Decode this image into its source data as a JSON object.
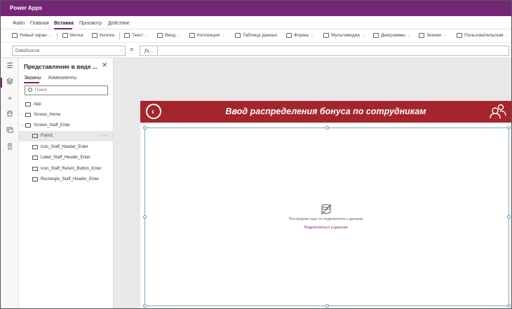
{
  "app": {
    "name": "Power Apps"
  },
  "menu": {
    "items": [
      {
        "label": "Файл",
        "active": false
      },
      {
        "label": "Главная",
        "active": false
      },
      {
        "label": "Вставка",
        "active": true
      },
      {
        "label": "Просмотр",
        "active": false
      },
      {
        "label": "Действие",
        "active": false
      }
    ]
  },
  "ribbon": {
    "new_screen": "Новый экран",
    "label": "Метка",
    "button": "Кнопка",
    "text": "Текст",
    "input": "Ввод",
    "gallery": "Коллекция",
    "data_table": "Таблица данных",
    "forms": "Формы",
    "media": "Мультимедиа",
    "charts": "Диаграммы",
    "icons": "Значки",
    "custom": "Пользовательская"
  },
  "formula": {
    "property": "DataSource",
    "equals": "=",
    "fx": "fx",
    "value": ""
  },
  "tree": {
    "title": "Представление в виде ...",
    "tabs": {
      "screens": "Экраны",
      "components": "Компоненты"
    },
    "search_placeholder": "Поиск",
    "items": [
      {
        "label": "App"
      },
      {
        "label": "Screen_Home"
      },
      {
        "label": "Screen_Staff_Enter"
      },
      {
        "label": "Form1"
      },
      {
        "label": "Icon_Staff_Header_Enter"
      },
      {
        "label": "Label_Staff_Header_Enter"
      },
      {
        "label": "Icon_Staff_Return_Button_Enter"
      },
      {
        "label": "Rectangle_Staff_Header_Enter"
      }
    ],
    "more": "..."
  },
  "screen": {
    "header_title": "Ввод распределения бонуса по сотрудникам",
    "header_color": "#a4262c",
    "empty_message": "Эта форма еще не подключена к данным",
    "connect_link": "Подключиться к данным"
  },
  "colors": {
    "brand": "#742774",
    "header": "#a4262c",
    "canvas": "#e8e8e8"
  }
}
